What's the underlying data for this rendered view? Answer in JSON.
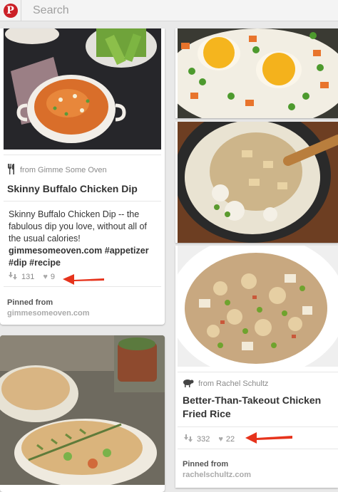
{
  "search": {
    "placeholder": "Search"
  },
  "colors": {
    "brand": "#cb2027",
    "arrow": "#e6331c"
  },
  "pins": [
    {
      "source_prefix": "from",
      "source": "from Gimme Some Oven",
      "title": "Skinny Buffalo Chicken Dip",
      "description_lines": [
        "Skinny Buffalo Chicken Dip -- the",
        "fabulous dip you love, without all of",
        "the usual calories!",
        "gimmesomeoven.com #appetizer",
        "#dip #recipe"
      ],
      "repins": "131",
      "likes": "9",
      "pinned_from_label": "Pinned from",
      "pinned_from": "gimmesomeoven.com",
      "source_icon": "fork-knife-icon"
    },
    {
      "source": "from Rachel Schultz",
      "title_lines": [
        "Better-Than-Takeout Chicken",
        "Fried Rice"
      ],
      "repins": "332",
      "likes": "22",
      "pinned_from_label": "Pinned from",
      "pinned_from": "rachelschultz.com",
      "source_icon": "sheep-icon"
    }
  ]
}
